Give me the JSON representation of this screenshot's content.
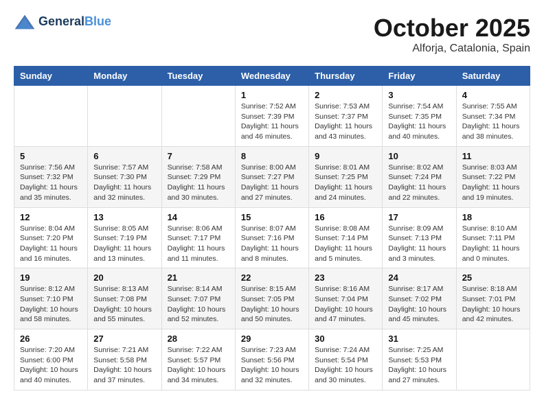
{
  "header": {
    "logo_line1": "General",
    "logo_line2": "Blue",
    "month": "October 2025",
    "location": "Alforja, Catalonia, Spain"
  },
  "weekdays": [
    "Sunday",
    "Monday",
    "Tuesday",
    "Wednesday",
    "Thursday",
    "Friday",
    "Saturday"
  ],
  "weeks": [
    [
      {
        "day": "",
        "info": ""
      },
      {
        "day": "",
        "info": ""
      },
      {
        "day": "",
        "info": ""
      },
      {
        "day": "1",
        "info": "Sunrise: 7:52 AM\nSunset: 7:39 PM\nDaylight: 11 hours and 46 minutes."
      },
      {
        "day": "2",
        "info": "Sunrise: 7:53 AM\nSunset: 7:37 PM\nDaylight: 11 hours and 43 minutes."
      },
      {
        "day": "3",
        "info": "Sunrise: 7:54 AM\nSunset: 7:35 PM\nDaylight: 11 hours and 40 minutes."
      },
      {
        "day": "4",
        "info": "Sunrise: 7:55 AM\nSunset: 7:34 PM\nDaylight: 11 hours and 38 minutes."
      }
    ],
    [
      {
        "day": "5",
        "info": "Sunrise: 7:56 AM\nSunset: 7:32 PM\nDaylight: 11 hours and 35 minutes."
      },
      {
        "day": "6",
        "info": "Sunrise: 7:57 AM\nSunset: 7:30 PM\nDaylight: 11 hours and 32 minutes."
      },
      {
        "day": "7",
        "info": "Sunrise: 7:58 AM\nSunset: 7:29 PM\nDaylight: 11 hours and 30 minutes."
      },
      {
        "day": "8",
        "info": "Sunrise: 8:00 AM\nSunset: 7:27 PM\nDaylight: 11 hours and 27 minutes."
      },
      {
        "day": "9",
        "info": "Sunrise: 8:01 AM\nSunset: 7:25 PM\nDaylight: 11 hours and 24 minutes."
      },
      {
        "day": "10",
        "info": "Sunrise: 8:02 AM\nSunset: 7:24 PM\nDaylight: 11 hours and 22 minutes."
      },
      {
        "day": "11",
        "info": "Sunrise: 8:03 AM\nSunset: 7:22 PM\nDaylight: 11 hours and 19 minutes."
      }
    ],
    [
      {
        "day": "12",
        "info": "Sunrise: 8:04 AM\nSunset: 7:20 PM\nDaylight: 11 hours and 16 minutes."
      },
      {
        "day": "13",
        "info": "Sunrise: 8:05 AM\nSunset: 7:19 PM\nDaylight: 11 hours and 13 minutes."
      },
      {
        "day": "14",
        "info": "Sunrise: 8:06 AM\nSunset: 7:17 PM\nDaylight: 11 hours and 11 minutes."
      },
      {
        "day": "15",
        "info": "Sunrise: 8:07 AM\nSunset: 7:16 PM\nDaylight: 11 hours and 8 minutes."
      },
      {
        "day": "16",
        "info": "Sunrise: 8:08 AM\nSunset: 7:14 PM\nDaylight: 11 hours and 5 minutes."
      },
      {
        "day": "17",
        "info": "Sunrise: 8:09 AM\nSunset: 7:13 PM\nDaylight: 11 hours and 3 minutes."
      },
      {
        "day": "18",
        "info": "Sunrise: 8:10 AM\nSunset: 7:11 PM\nDaylight: 11 hours and 0 minutes."
      }
    ],
    [
      {
        "day": "19",
        "info": "Sunrise: 8:12 AM\nSunset: 7:10 PM\nDaylight: 10 hours and 58 minutes."
      },
      {
        "day": "20",
        "info": "Sunrise: 8:13 AM\nSunset: 7:08 PM\nDaylight: 10 hours and 55 minutes."
      },
      {
        "day": "21",
        "info": "Sunrise: 8:14 AM\nSunset: 7:07 PM\nDaylight: 10 hours and 52 minutes."
      },
      {
        "day": "22",
        "info": "Sunrise: 8:15 AM\nSunset: 7:05 PM\nDaylight: 10 hours and 50 minutes."
      },
      {
        "day": "23",
        "info": "Sunrise: 8:16 AM\nSunset: 7:04 PM\nDaylight: 10 hours and 47 minutes."
      },
      {
        "day": "24",
        "info": "Sunrise: 8:17 AM\nSunset: 7:02 PM\nDaylight: 10 hours and 45 minutes."
      },
      {
        "day": "25",
        "info": "Sunrise: 8:18 AM\nSunset: 7:01 PM\nDaylight: 10 hours and 42 minutes."
      }
    ],
    [
      {
        "day": "26",
        "info": "Sunrise: 7:20 AM\nSunset: 6:00 PM\nDaylight: 10 hours and 40 minutes."
      },
      {
        "day": "27",
        "info": "Sunrise: 7:21 AM\nSunset: 5:58 PM\nDaylight: 10 hours and 37 minutes."
      },
      {
        "day": "28",
        "info": "Sunrise: 7:22 AM\nSunset: 5:57 PM\nDaylight: 10 hours and 34 minutes."
      },
      {
        "day": "29",
        "info": "Sunrise: 7:23 AM\nSunset: 5:56 PM\nDaylight: 10 hours and 32 minutes."
      },
      {
        "day": "30",
        "info": "Sunrise: 7:24 AM\nSunset: 5:54 PM\nDaylight: 10 hours and 30 minutes."
      },
      {
        "day": "31",
        "info": "Sunrise: 7:25 AM\nSunset: 5:53 PM\nDaylight: 10 hours and 27 minutes."
      },
      {
        "day": "",
        "info": ""
      }
    ]
  ]
}
